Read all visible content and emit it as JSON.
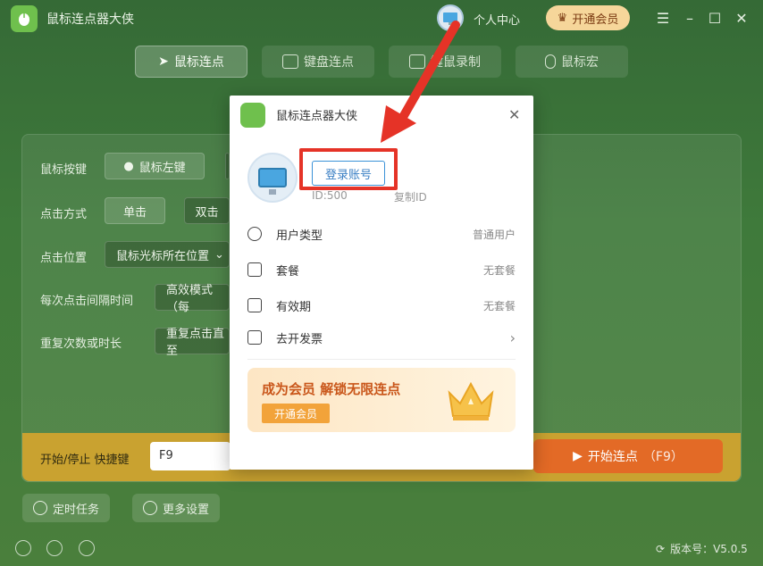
{
  "app": {
    "title": "鼠标连点器大侠"
  },
  "titlebar": {
    "user_center": "个人中心",
    "vip_button": "开通会员"
  },
  "tabs": [
    {
      "label": "鼠标连点",
      "icon": "cursor-icon"
    },
    {
      "label": "键盘连点",
      "icon": "keyboard-icon"
    },
    {
      "label": "键鼠录制",
      "icon": "record-icon"
    },
    {
      "label": "鼠标宏",
      "icon": "mouse-icon"
    }
  ],
  "settings": {
    "mouse_button_label": "鼠标按键",
    "mouse_button_value": "鼠标左键",
    "click_mode_label": "点击方式",
    "click_single": "单击",
    "click_double": "双击",
    "click_position_label": "点击位置",
    "click_position_value": "鼠标光标所在位置",
    "interval_label": "每次点击间隔时间",
    "interval_value": "高效模式（每",
    "repeat_label": "重复次数或时长",
    "repeat_value": "重复点击直至"
  },
  "hotkey": {
    "label": "开始/停止 快捷键",
    "value": "F9"
  },
  "start_button": {
    "label": "开始连点",
    "hint": "（F9）"
  },
  "bottom": {
    "timer_task": "定时任务",
    "more_settings": "更多设置",
    "version": "版本号：V5.0.5"
  },
  "popup": {
    "title": "鼠标连点器大侠",
    "login_button": "登录账号",
    "user_id": "ID:500",
    "copy_id": "复制ID",
    "rows": [
      {
        "label": "用户类型",
        "value": "普通用户",
        "icon": "user-icon"
      },
      {
        "label": "套餐",
        "value": "无套餐",
        "icon": "bag-icon"
      },
      {
        "label": "有效期",
        "value": "无套餐",
        "icon": "calendar-icon"
      },
      {
        "label": "去开发票",
        "value": "›",
        "icon": "invoice-icon"
      }
    ],
    "promo_title": "成为会员 解锁无限连点",
    "promo_button": "开通会员"
  },
  "colors": {
    "accent_red": "#e53327",
    "primary_green": "#3f7a3b",
    "orange": "#e36a26",
    "link_blue": "#3a92d8"
  }
}
